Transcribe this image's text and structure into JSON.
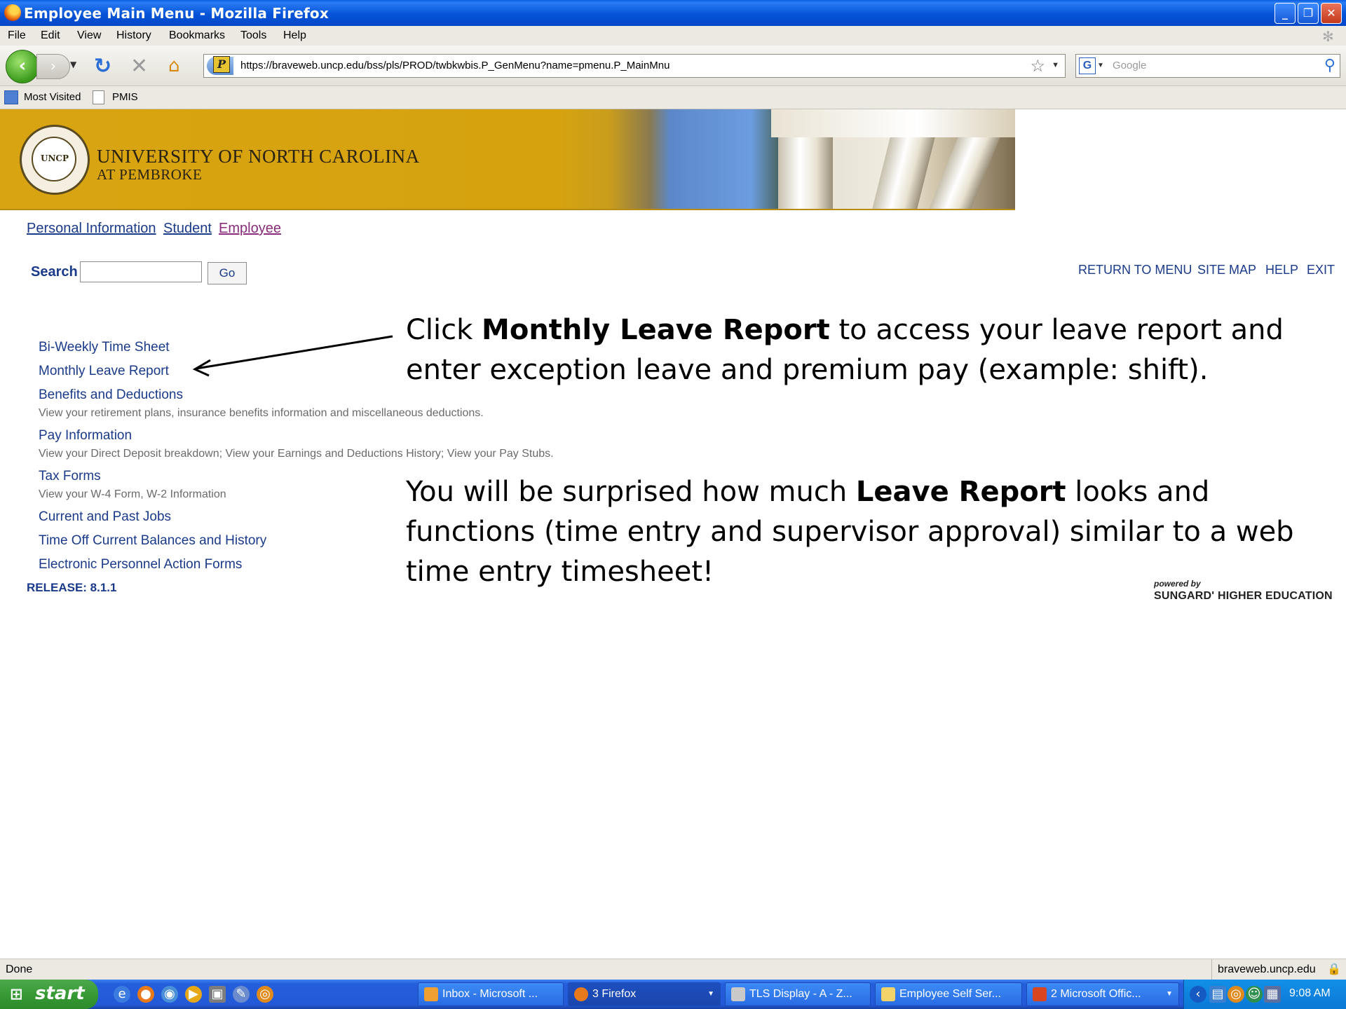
{
  "window": {
    "title": "Employee Main Menu - Mozilla Firefox",
    "minimize": "_",
    "restore": "❐",
    "close": "✕"
  },
  "menu": [
    "File",
    "Edit",
    "View",
    "History",
    "Bookmarks",
    "Tools",
    "Help"
  ],
  "toolbar": {
    "url": "https://braveweb.uncp.edu/bss/pls/PROD/twbkwbis.P_GenMenu?name=pmenu.P_MainMnu",
    "search_placeholder": "Google",
    "site_icon_letter": "P"
  },
  "bookmarks": [
    "Most Visited",
    "PMIS"
  ],
  "banner": {
    "line1": "UNIVERSITY OF NORTH CAROLINA",
    "line2": "AT PEMBROKE",
    "seal_text": "UNCP"
  },
  "tabs": [
    "Personal Information",
    "Student",
    "Employee"
  ],
  "search": {
    "label": "Search",
    "value": "",
    "go": "Go"
  },
  "top_links": [
    "RETURN TO MENU",
    "SITE MAP",
    "HELP",
    "EXIT"
  ],
  "menu_items": {
    "bi_weekly": "Bi-Weekly Time Sheet",
    "monthly_leave": "Monthly Leave Report",
    "benefits": "Benefits and Deductions",
    "benefits_desc": "View your retirement plans, insurance benefits information and miscellaneous deductions.",
    "pay_info": "Pay Information",
    "pay_info_desc": "View your Direct Deposit breakdown; View your Earnings and Deductions History; View your Pay Stubs.",
    "tax_forms": "Tax Forms",
    "tax_forms_desc": "View your W-4 Form, W-2 Information",
    "jobs": "Current and Past Jobs",
    "time_off": "Time Off Current Balances and History",
    "epaf": "Electronic Personnel Action Forms"
  },
  "release": "RELEASE: 8.1.1",
  "annotation1": {
    "l1_pre": "Click ",
    "l1_bold": "Monthly Leave Report",
    "l1_post": " to access your leave report and",
    "l2": "enter exception leave and premium pay (example: shift)."
  },
  "annotation2": {
    "l1_pre": "You will be surprised how much ",
    "l1_bold": "Leave Report",
    "l1_post": " looks and",
    "l2": "functions (time entry and supervisor approval) similar to a web",
    "l3": "time entry timesheet!"
  },
  "powered": {
    "line1": "powered by",
    "line2": "SUNGARD' HIGHER EDUCATION"
  },
  "status": {
    "left": "Done",
    "domain": "braveweb.uncp.edu"
  },
  "taskbar": {
    "start": "start",
    "tasks": [
      "Inbox - Microsoft ...",
      "3 Firefox",
      "TLS Display - A - Z...",
      "Employee Self Ser...",
      "2 Microsoft Offic..."
    ],
    "clock": "9:08 AM"
  },
  "colors": {
    "link": "#1a3a8a",
    "visited": "#8a2d7a",
    "banner_gold": "#d8a411",
    "taskbar": "#245edb"
  }
}
